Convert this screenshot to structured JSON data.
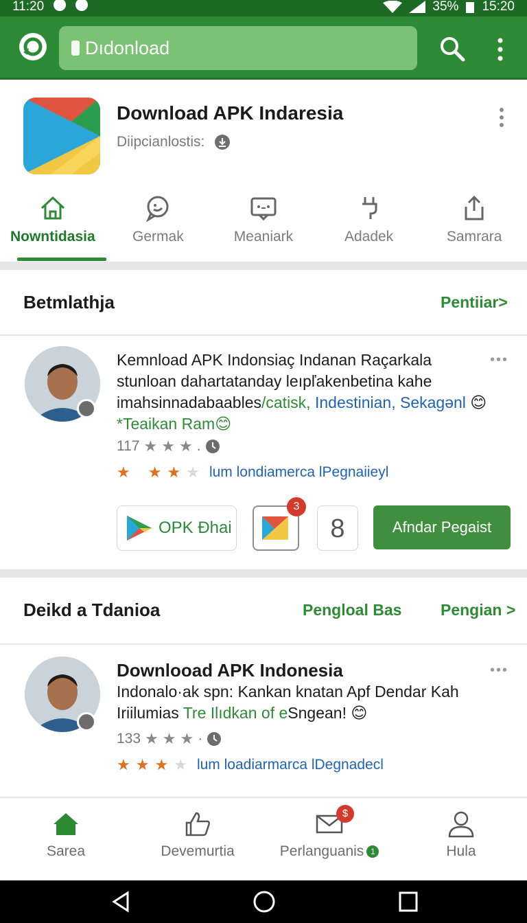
{
  "status_bar": {
    "time_left": "11:20",
    "battery": "35%",
    "time_right": "15:20"
  },
  "app_bar": {
    "search_text": "Dıdonload"
  },
  "app_header": {
    "title": "Download APK Indaresia",
    "subtitle": "Diipcianlostis:"
  },
  "tabs": [
    {
      "label": "Nowntidasia",
      "icon": "home-icon",
      "active": true
    },
    {
      "label": "Germak",
      "icon": "chat-icon",
      "active": false
    },
    {
      "label": "Meaniark",
      "icon": "message-icon",
      "active": false
    },
    {
      "label": "Adadek",
      "icon": "plug-icon",
      "active": false
    },
    {
      "label": "Samrara",
      "icon": "share-icon",
      "active": false
    }
  ],
  "section1": {
    "title": "Betmlathja",
    "link": "Pentiiar>",
    "post": {
      "line1": "Kemnload APK Indonsiaç Indanan Raçarkala",
      "line2": "stunloan dahartatanday leıpľakenbetina kahe",
      "line3_a": "imahsinnadabaables",
      "line3_b": "/catisk,",
      "line3_c": "Indestinian, Sekagənl",
      "line3_emoji": "😊",
      "line4": "*Teaikan Ram",
      "line4_emoji": "😊",
      "count": "117",
      "stars_label": "lum londiamerca lPegnaiieyl",
      "more": "•••"
    },
    "actions": {
      "opk_label": "OPK Ðhai",
      "badge_count": "3",
      "eight_label": "8",
      "primary_label": "Afndar Pegaist"
    }
  },
  "section2": {
    "title": "Deikd a Tdanioa",
    "link_middle": "Pengloal Bas",
    "link_right": "Pengian >",
    "post": {
      "title": "Downlooad APK Indonesia",
      "line2": "Indonalo·ak spn: Kankan knatan Apf Dendar Kah",
      "line3_a": "Iriilumias",
      "line3_b": "Tre Ilıdkan of e",
      "line3_c": "Sngean!",
      "line3_emoji": "😊",
      "count": "133",
      "stars_label": "lum loadiarmarca lDegnadecl",
      "more": "•••"
    }
  },
  "bottom_nav": [
    {
      "label": "Sarea",
      "icon": "home-icon"
    },
    {
      "label": "Devemurtia",
      "icon": "thumbs-up-icon"
    },
    {
      "label": "Perlanguanis",
      "icon": "message-icon",
      "badge": "$",
      "small_badge": "1"
    },
    {
      "label": "Hula",
      "icon": "person-icon"
    }
  ],
  "colors": {
    "primary": "#2e8b35",
    "link_blue": "#1f63b8",
    "badge_red": "#d33a2c",
    "star_orange": "#e0701d"
  }
}
